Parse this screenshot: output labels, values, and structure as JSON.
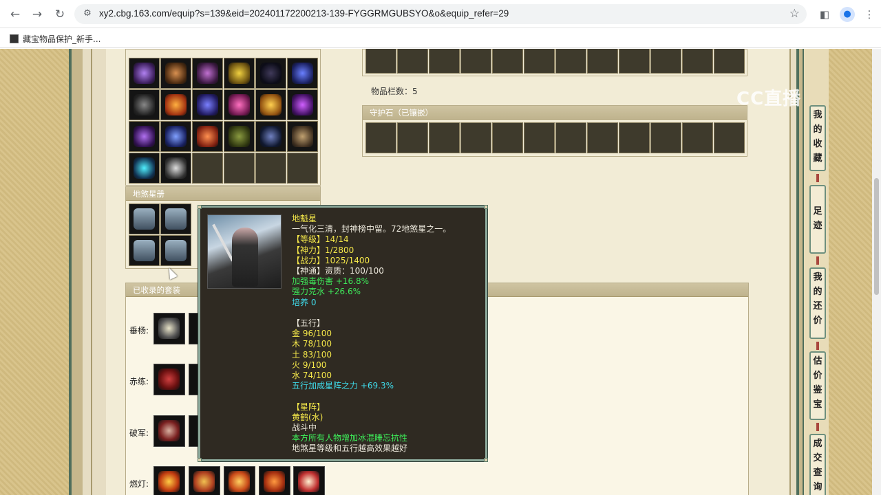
{
  "browser": {
    "url": "xy2.cbg.163.com/equip?s=139&eid=202401172200213-139-FYGGRMGUBSYO&o&equip_refer=29",
    "bookmark": "藏宝物品保护_新手..."
  },
  "overlay_brand": "CC直播",
  "inventory": {
    "slot_count_label": "物品栏数：5",
    "guard_stone_title": "守护石（已镶嵌）"
  },
  "star_book": {
    "title": "地煞星册"
  },
  "suits": {
    "title": "已收录的套装",
    "rows": [
      {
        "label": "垂杨:"
      },
      {
        "label": "赤练:"
      },
      {
        "label": "破军:"
      },
      {
        "label": "燃灯:"
      }
    ]
  },
  "sidebar": {
    "items": [
      {
        "label": "我的收藏"
      },
      {
        "label": "足迹"
      },
      {
        "label": "我的还价"
      },
      {
        "label": "估价鉴宝"
      },
      {
        "label": "成交查询"
      }
    ]
  },
  "tooltip": {
    "name": "地魁星",
    "desc": "一气化三清，封神榜中留。72地煞星之一。",
    "level": "【等级】14/14",
    "divine": "【神力】1/2800",
    "combat": "【战力】1025/1400",
    "talent": "【神通】资质：100/100",
    "bonus1": "加强毒伤害 +16.8%",
    "bonus2": "强力克水 +26.6%",
    "cultivate": "培养 0",
    "wuxing_title": "【五行】",
    "wuxing": [
      "金 96/100",
      "木 78/100",
      "土 83/100",
      "火 9/100",
      "水 74/100"
    ],
    "wuxing_bonus": "五行加成星阵之力 +69.3%",
    "formation_title": "【星阵】",
    "formation_name": "黄鹤(水)",
    "formation_state": "战斗中",
    "formation_effect": "本方所有人物增加冰混睡忘抗性",
    "formation_note": "地煞星等级和五行越高效果越好"
  }
}
